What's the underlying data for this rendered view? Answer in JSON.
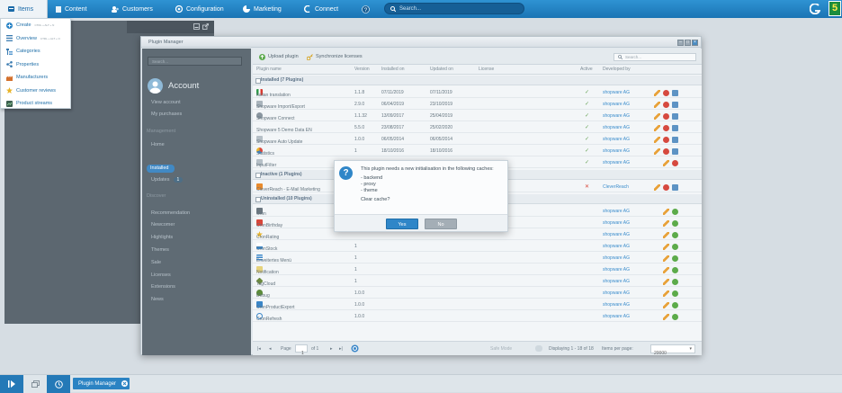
{
  "topbar": {
    "menu": [
      {
        "label": "Items",
        "icon": "items-icon"
      },
      {
        "label": "Content",
        "icon": "content-icon"
      },
      {
        "label": "Customers",
        "icon": "customers-icon"
      },
      {
        "label": "Configuration",
        "icon": "configuration-icon"
      },
      {
        "label": "Marketing",
        "icon": "marketing-icon"
      },
      {
        "label": "Connect",
        "icon": "connect-icon"
      }
    ],
    "search_placeholder": "Search...",
    "brand_color": "#2a8ad1"
  },
  "dropdown": {
    "items": [
      {
        "label": "Create",
        "shortcut": "CTRL + ALT + N"
      },
      {
        "label": "Overview",
        "shortcut": "CTRL + ALT + O"
      },
      {
        "label": "Categories",
        "shortcut": ""
      },
      {
        "label": "Properties",
        "shortcut": ""
      },
      {
        "label": "Manufacturers",
        "shortcut": ""
      },
      {
        "label": "Customer reviews",
        "shortcut": ""
      },
      {
        "label": "Product streams",
        "shortcut": ""
      }
    ]
  },
  "plugin_manager": {
    "title": "Plugin Manager",
    "sidebar": {
      "search_placeholder": "Search...",
      "account_title": "Account",
      "account_links": [
        "View account",
        "My purchases"
      ],
      "management_heading": "Management",
      "management_links": [
        "Home",
        "Installed",
        "Updates"
      ],
      "updates_badge": "1",
      "discover_heading": "Discover",
      "discover_links": [
        "Recommendation",
        "Newcomer",
        "Highlights",
        "Themes",
        "Sale",
        "Licenses",
        "Extensions",
        "News"
      ]
    },
    "toolbar": {
      "upload_label": "Upload plugin",
      "sync_label": "Synchronize licenses",
      "search_placeholder": "Search..."
    },
    "columns": [
      "Plugin name",
      "Version",
      "Installed on",
      "Updated on",
      "License",
      "Active",
      "Developed by"
    ],
    "groups": {
      "installed": "Installed (7 Plugins)",
      "inactive": "Inactive (1 Plugins)",
      "uninstalled": "Uninstalled (10 Plugins)"
    },
    "installed_rows": [
      {
        "name": "Italian translation",
        "version": "1.1.8",
        "installed": "07/11/2019",
        "updated": "07/11/2019",
        "active": "✓",
        "dev": "shopware AG"
      },
      {
        "name": "Shopware Import/Export",
        "version": "2.9.0",
        "installed": "06/04/2019",
        "updated": "23/10/2019",
        "active": "✓",
        "dev": "shopware AG"
      },
      {
        "name": "Shopware Connect",
        "version": "1.1.32",
        "installed": "13/09/2017",
        "updated": "25/04/2019",
        "active": "✓",
        "dev": "shopware AG"
      },
      {
        "name": "Shopware 5 Demo Data EN",
        "version": "5.5.0",
        "installed": "23/08/2017",
        "updated": "25/02/2020",
        "active": "✓",
        "dev": "shopware AG"
      },
      {
        "name": "Shopware Auto Update",
        "version": "1.0.0",
        "installed": "06/05/2014",
        "updated": "06/05/2014",
        "active": "✓",
        "dev": "shopware AG"
      },
      {
        "name": "Statistics",
        "version": "1",
        "installed": "18/10/2016",
        "updated": "18/10/2016",
        "active": "✓",
        "dev": "shopware AG"
      },
      {
        "name": "InputFilter",
        "version": "1",
        "installed": "",
        "updated": "",
        "active": "✓",
        "dev": "shopware AG"
      }
    ],
    "inactive_rows": [
      {
        "name": "CleverReach - E-Mail Marketing",
        "version": "",
        "installed": "",
        "updated": "",
        "active": "✕",
        "dev": "CleverReach"
      }
    ],
    "uninstalled_rows": [
      {
        "name": "Cron",
        "version": "",
        "dev": "shopware AG"
      },
      {
        "name": "CronBirthday",
        "version": "",
        "dev": "shopware AG"
      },
      {
        "name": "CronRating",
        "version": "",
        "dev": "shopware AG"
      },
      {
        "name": "CronStock",
        "version": "1",
        "dev": "shopware AG"
      },
      {
        "name": "Erweitertes Menü",
        "version": "1",
        "dev": "shopware AG"
      },
      {
        "name": "Notification",
        "version": "1",
        "dev": "shopware AG"
      },
      {
        "name": "TagCloud",
        "version": "1",
        "dev": "shopware AG"
      },
      {
        "name": "Debug",
        "version": "1.0.0",
        "dev": "shopware AG"
      },
      {
        "name": "CronProductExport",
        "version": "1.0.0",
        "dev": "shopware AG"
      },
      {
        "name": "CronRefresh",
        "version": "1.0.0",
        "dev": "shopware AG"
      }
    ],
    "pager": {
      "page_label": "Page",
      "page_value": "1",
      "of_label": "of 1",
      "safe_mode": "Safe Mode",
      "displaying": "Displaying 1 - 18 of 18",
      "per_page_label": "Items per page:",
      "per_page_value": "20000"
    }
  },
  "modal": {
    "message": "This plugin needs a new initialisation in the following caches:",
    "caches": [
      "- backend",
      "- proxy",
      "- theme"
    ],
    "question": "Clear cache?",
    "yes_label": "Yes",
    "no_label": "No"
  },
  "taskbar": {
    "window_label": "Plugin Manager"
  }
}
